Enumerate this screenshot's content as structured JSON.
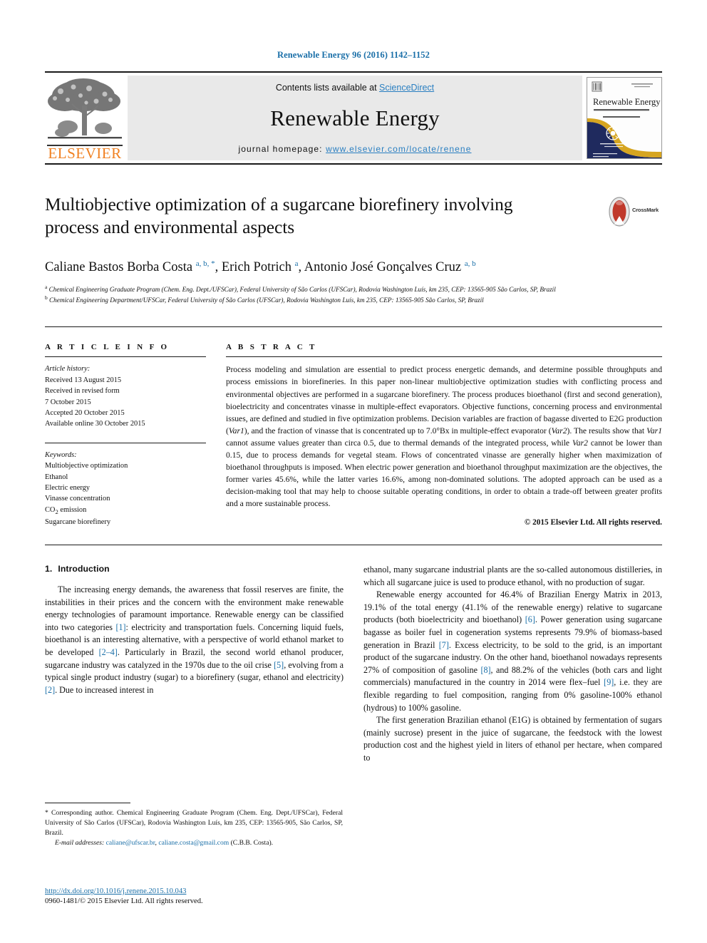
{
  "running_head": "Renewable Energy 96 (2016) 1142–1152",
  "masthead": {
    "publisher_name": "ELSEVIER",
    "contents_prefix": "Contents lists available at ",
    "contents_link": "ScienceDirect",
    "journal_title": "Renewable Energy",
    "homepage_prefix": "journal homepage: ",
    "homepage_url": "www.elsevier.com/locate/renene",
    "cover": {
      "title": "Renewable Energy",
      "subtitle": "AN INTERNATIONAL JOURNAL",
      "editor_line": "Editor-in-Chief: Soteris Kalogirou"
    }
  },
  "article": {
    "title": "Multiobjective optimization of a sugarcane biorefinery involving process and environmental aspects",
    "crossmark_label": "CrossMark",
    "authors_html": "Caliane Bastos Borba Costa <sup>a, b, *</sup>, Erich Potrich <sup>a</sup>, Antonio José Gonçalves Cruz <sup>a, b</sup>",
    "affiliations": [
      "a Chemical Engineering Graduate Program (Chem. Eng. Dept./UFSCar), Federal University of São Carlos (UFSCar), Rodovia Washington Luís, km 235, CEP: 13565-905 São Carlos, SP, Brazil",
      "b Chemical Engineering Department/UFSCar, Federal University of São Carlos (UFSCar), Rodovia Washington Luís, km 235, CEP: 13565-905 São Carlos, SP, Brazil"
    ]
  },
  "article_info": {
    "label": "A R T I C L E   I N F O",
    "history_label": "Article history:",
    "history": [
      "Received 13 August 2015",
      "Received in revised form",
      "7 October 2015",
      "Accepted 20 October 2015",
      "Available online 30 October 2015"
    ],
    "keywords_label": "Keywords:",
    "keywords": [
      "Multiobjective optimization",
      "Ethanol",
      "Electric energy",
      "Vinasse concentration",
      "CO2 emission",
      "Sugarcane biorefinery"
    ],
    "keyword_co2_html": "CO<sub>2</sub> emission"
  },
  "abstract": {
    "label": "A B S T R A C T",
    "text_html": "Process modeling and simulation are essential to predict process energetic demands, and determine possible throughputs and process emissions in biorefineries. In this paper non-linear multiobjective optimization studies with conflicting process and environmental objectives are performed in a sugarcane biorefinery. The process produces bioethanol (first and second generation), bioelectricity and concentrates vinasse in multiple-effect evaporators. Objective functions, concerning process and environmental issues, are defined and studied in five optimization problems. Decision variables are fraction of bagasse diverted to E2G production (<i>Var1</i>), and the fraction of vinasse that is concentrated up to 7.0&#176;Bx in multiple-effect evaporator (<i>Var2</i>). The results show that <i>Var1</i> cannot assume values greater than circa 0.5, due to thermal demands of the integrated process, while <i>Var2</i> cannot be lower than 0.15, due to process demands for vegetal steam. Flows of concentrated vinasse are generally higher when maximization of bioethanol throughputs is imposed. When electric power generation and bioethanol throughput maximization are the objectives, the former varies 45.6%, while the latter varies 16.6%, among non-dominated solutions. The adopted approach can be used as a decision-making tool that may help to choose suitable operating conditions, in order to obtain a trade-off between greater profits and a more sustainable process.",
    "copyright": "© 2015 Elsevier Ltd. All rights reserved."
  },
  "introduction": {
    "number": "1.",
    "heading": "Introduction",
    "left_paragraphs_html": [
      "The increasing energy demands, the awareness that fossil reserves are finite, the instabilities in their prices and the concern with the environment make renewable energy technologies of paramount importance. Renewable energy can be classified into two categories <span class=\"ref\">[1]</span>: electricity and transportation fuels. Concerning liquid fuels, bioethanol is an interesting alternative, with a perspective of world ethanol market to be developed <span class=\"ref\">[2&#8211;4]</span>. Particularly in Brazil, the second world ethanol producer, sugarcane industry was catalyzed in the 1970s due to the oil crise <span class=\"ref\">[5]</span>, evolving from a typical single product industry (sugar) to a biorefinery (sugar, ethanol and electricity) <span class=\"ref\">[2]</span>. Due to increased interest in"
    ],
    "right_paragraphs_html": [
      "ethanol, many sugarcane industrial plants are the so-called autonomous distilleries, in which all sugarcane juice is used to produce ethanol, with no production of sugar.",
      "Renewable energy accounted for 46.4% of Brazilian Energy Matrix in 2013, 19.1% of the total energy (41.1% of the renewable energy) relative to sugarcane products (both bioelectricity and bioethanol) <span class=\"ref\">[6]</span>. Power generation using sugarcane bagasse as boiler fuel in cogeneration systems represents 79.9% of biomass-based generation in Brazil <span class=\"ref\">[7]</span>. Excess electricity, to be sold to the grid, is an important product of the sugarcane industry. On the other hand, bioethanol nowadays represents 27% of composition of gasoline <span class=\"ref\">[8]</span>, and 88.2% of the vehicles (both cars and light commercials) manufactured in the country in 2014 were flex&#8211;fuel <span class=\"ref\">[9]</span>, i.e. they are flexible regarding to fuel composition, ranging from 0% gasoline-100% ethanol (hydrous) to 100% gasoline.",
      "The first generation Brazilian ethanol (E1G) is obtained by fermentation of sugars (mainly sucrose) present in the juice of sugarcane, the feedstock with the lowest production cost and the highest yield in liters of ethanol per hectare, when compared to"
    ]
  },
  "footnote": {
    "corresponding_html": "* Corresponding author. Chemical Engineering Graduate Program (Chem. Eng. Dept./UFSCar), Federal University of São Carlos (UFSCar), Rodovia Washington Luís, km 235, CEP: 13565-905, São Carlos, SP, Brazil.",
    "email_label": "E-mail addresses:",
    "email_1": "caliane@ufscar.br",
    "email_2": "caliane.costa@gmail.com",
    "email_owner": "(C.B.B. Costa)."
  },
  "footer": {
    "doi": "http://dx.doi.org/10.1016/j.renene.2015.10.043",
    "issn": "0960-1481/© 2015 Elsevier Ltd. All rights reserved."
  },
  "colors": {
    "link_blue": "#1a6fa8",
    "elsevier_orange": "#f08122",
    "masthead_grey": "#e9e9e9",
    "cover_navy": "#1f2a5e",
    "cover_gold": "#d6a520",
    "crossmark_red": "#c0392b"
  }
}
